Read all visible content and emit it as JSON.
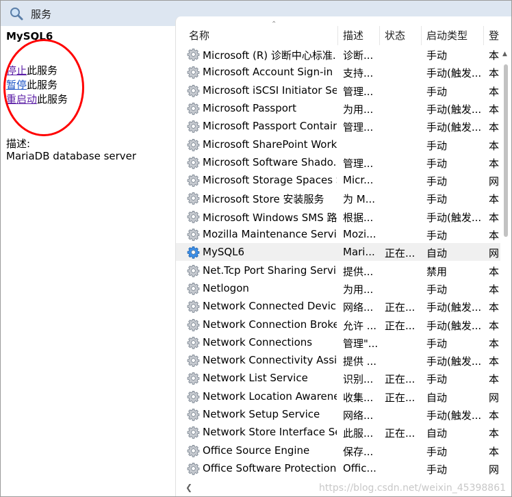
{
  "window": {
    "title": "服务",
    "icon": "services-magnifier-icon"
  },
  "left_pane": {
    "service_name": "MySQL6",
    "actions": [
      {
        "link": "停止",
        "suffix": "此服务"
      },
      {
        "link": "暂停",
        "suffix": "此服务"
      },
      {
        "link": "重启动",
        "suffix": "此服务"
      }
    ],
    "description_label": "描述:",
    "description_text": "MariaDB database server"
  },
  "columns": {
    "name": "名称",
    "desc": "描述",
    "status": "状态",
    "startup": "启动类型",
    "logon": "登"
  },
  "rows": [
    {
      "name": "Microsoft (R) 诊断中心标准...",
      "desc": "诊断...",
      "status": "",
      "startup": "手动",
      "logon": "本"
    },
    {
      "name": "Microsoft Account Sign-in ...",
      "desc": "支持...",
      "status": "",
      "startup": "手动(触发...",
      "logon": "本"
    },
    {
      "name": "Microsoft iSCSI Initiator Ser...",
      "desc": "管理...",
      "status": "",
      "startup": "手动",
      "logon": "本"
    },
    {
      "name": "Microsoft Passport",
      "desc": "为用...",
      "status": "",
      "startup": "手动(触发...",
      "logon": "本"
    },
    {
      "name": "Microsoft Passport Container",
      "desc": "管理...",
      "status": "",
      "startup": "手动(触发...",
      "logon": "本"
    },
    {
      "name": "Microsoft SharePoint Work...",
      "desc": "",
      "status": "",
      "startup": "手动",
      "logon": "本"
    },
    {
      "name": "Microsoft Software Shado...",
      "desc": "管理...",
      "status": "",
      "startup": "手动",
      "logon": "本"
    },
    {
      "name": "Microsoft Storage Spaces S...",
      "desc": "Micr...",
      "status": "",
      "startup": "手动",
      "logon": "网"
    },
    {
      "name": "Microsoft Store 安装服务",
      "desc": "为 M...",
      "status": "",
      "startup": "手动",
      "logon": "本"
    },
    {
      "name": "Microsoft Windows SMS 路...",
      "desc": "根据...",
      "status": "",
      "startup": "手动(触发...",
      "logon": "本"
    },
    {
      "name": "Mozilla Maintenance Service",
      "desc": "Mozi...",
      "status": "",
      "startup": "手动",
      "logon": "本"
    },
    {
      "name": "MySQL6",
      "desc": "Mari...",
      "status": "正在...",
      "startup": "自动",
      "logon": "网",
      "selected": true
    },
    {
      "name": "Net.Tcp Port Sharing Service",
      "desc": "提供...",
      "status": "",
      "startup": "禁用",
      "logon": "本"
    },
    {
      "name": "Netlogon",
      "desc": "为用...",
      "status": "",
      "startup": "手动",
      "logon": "本"
    },
    {
      "name": "Network Connected Devic...",
      "desc": "网络...",
      "status": "正在...",
      "startup": "手动(触发...",
      "logon": "本"
    },
    {
      "name": "Network Connection Broker",
      "desc": "允许 ...",
      "status": "正在...",
      "startup": "手动(触发...",
      "logon": "本"
    },
    {
      "name": "Network Connections",
      "desc": "管理\"...",
      "status": "",
      "startup": "手动",
      "logon": "本"
    },
    {
      "name": "Network Connectivity Assis...",
      "desc": "提供 ...",
      "status": "",
      "startup": "手动(触发...",
      "logon": "本"
    },
    {
      "name": "Network List Service",
      "desc": "识别...",
      "status": "正在...",
      "startup": "手动",
      "logon": "本"
    },
    {
      "name": "Network Location Awarene...",
      "desc": "收集...",
      "status": "正在...",
      "startup": "自动",
      "logon": "网"
    },
    {
      "name": "Network Setup Service",
      "desc": "网络...",
      "status": "",
      "startup": "手动(触发...",
      "logon": "本"
    },
    {
      "name": "Network Store Interface Se...",
      "desc": "此服...",
      "status": "正在...",
      "startup": "自动",
      "logon": "本"
    },
    {
      "name": "Office  Source Engine",
      "desc": "保存...",
      "status": "",
      "startup": "手动",
      "logon": "本"
    },
    {
      "name": "Office Software Protection ...",
      "desc": "Offic...",
      "status": "",
      "startup": "手动",
      "logon": "网"
    }
  ],
  "watermark": "https://blog.csdn.net/weixin_45398861",
  "colors": {
    "header_bg": "#dde6f1",
    "selected_row": "#f0f0f0",
    "link_visited": "#5b1ea6",
    "link_blue": "#1a52c6",
    "annotation": "#ff0000"
  }
}
